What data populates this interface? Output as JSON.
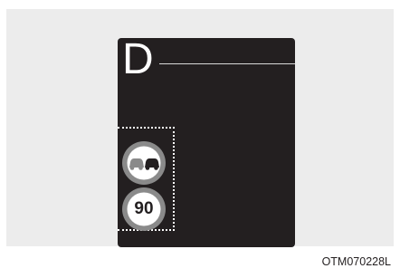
{
  "display": {
    "gear": "D"
  },
  "traffic_signs": {
    "no_passing_icon": "no-overtaking-sign-icon",
    "speed_limit": "90"
  },
  "figure_code": "OTM070228L",
  "colors": {
    "display_background": "#231f20",
    "panel_background": "#ececec",
    "sign_ring": "#8a8a8a",
    "sign_face": "#ffffff"
  }
}
